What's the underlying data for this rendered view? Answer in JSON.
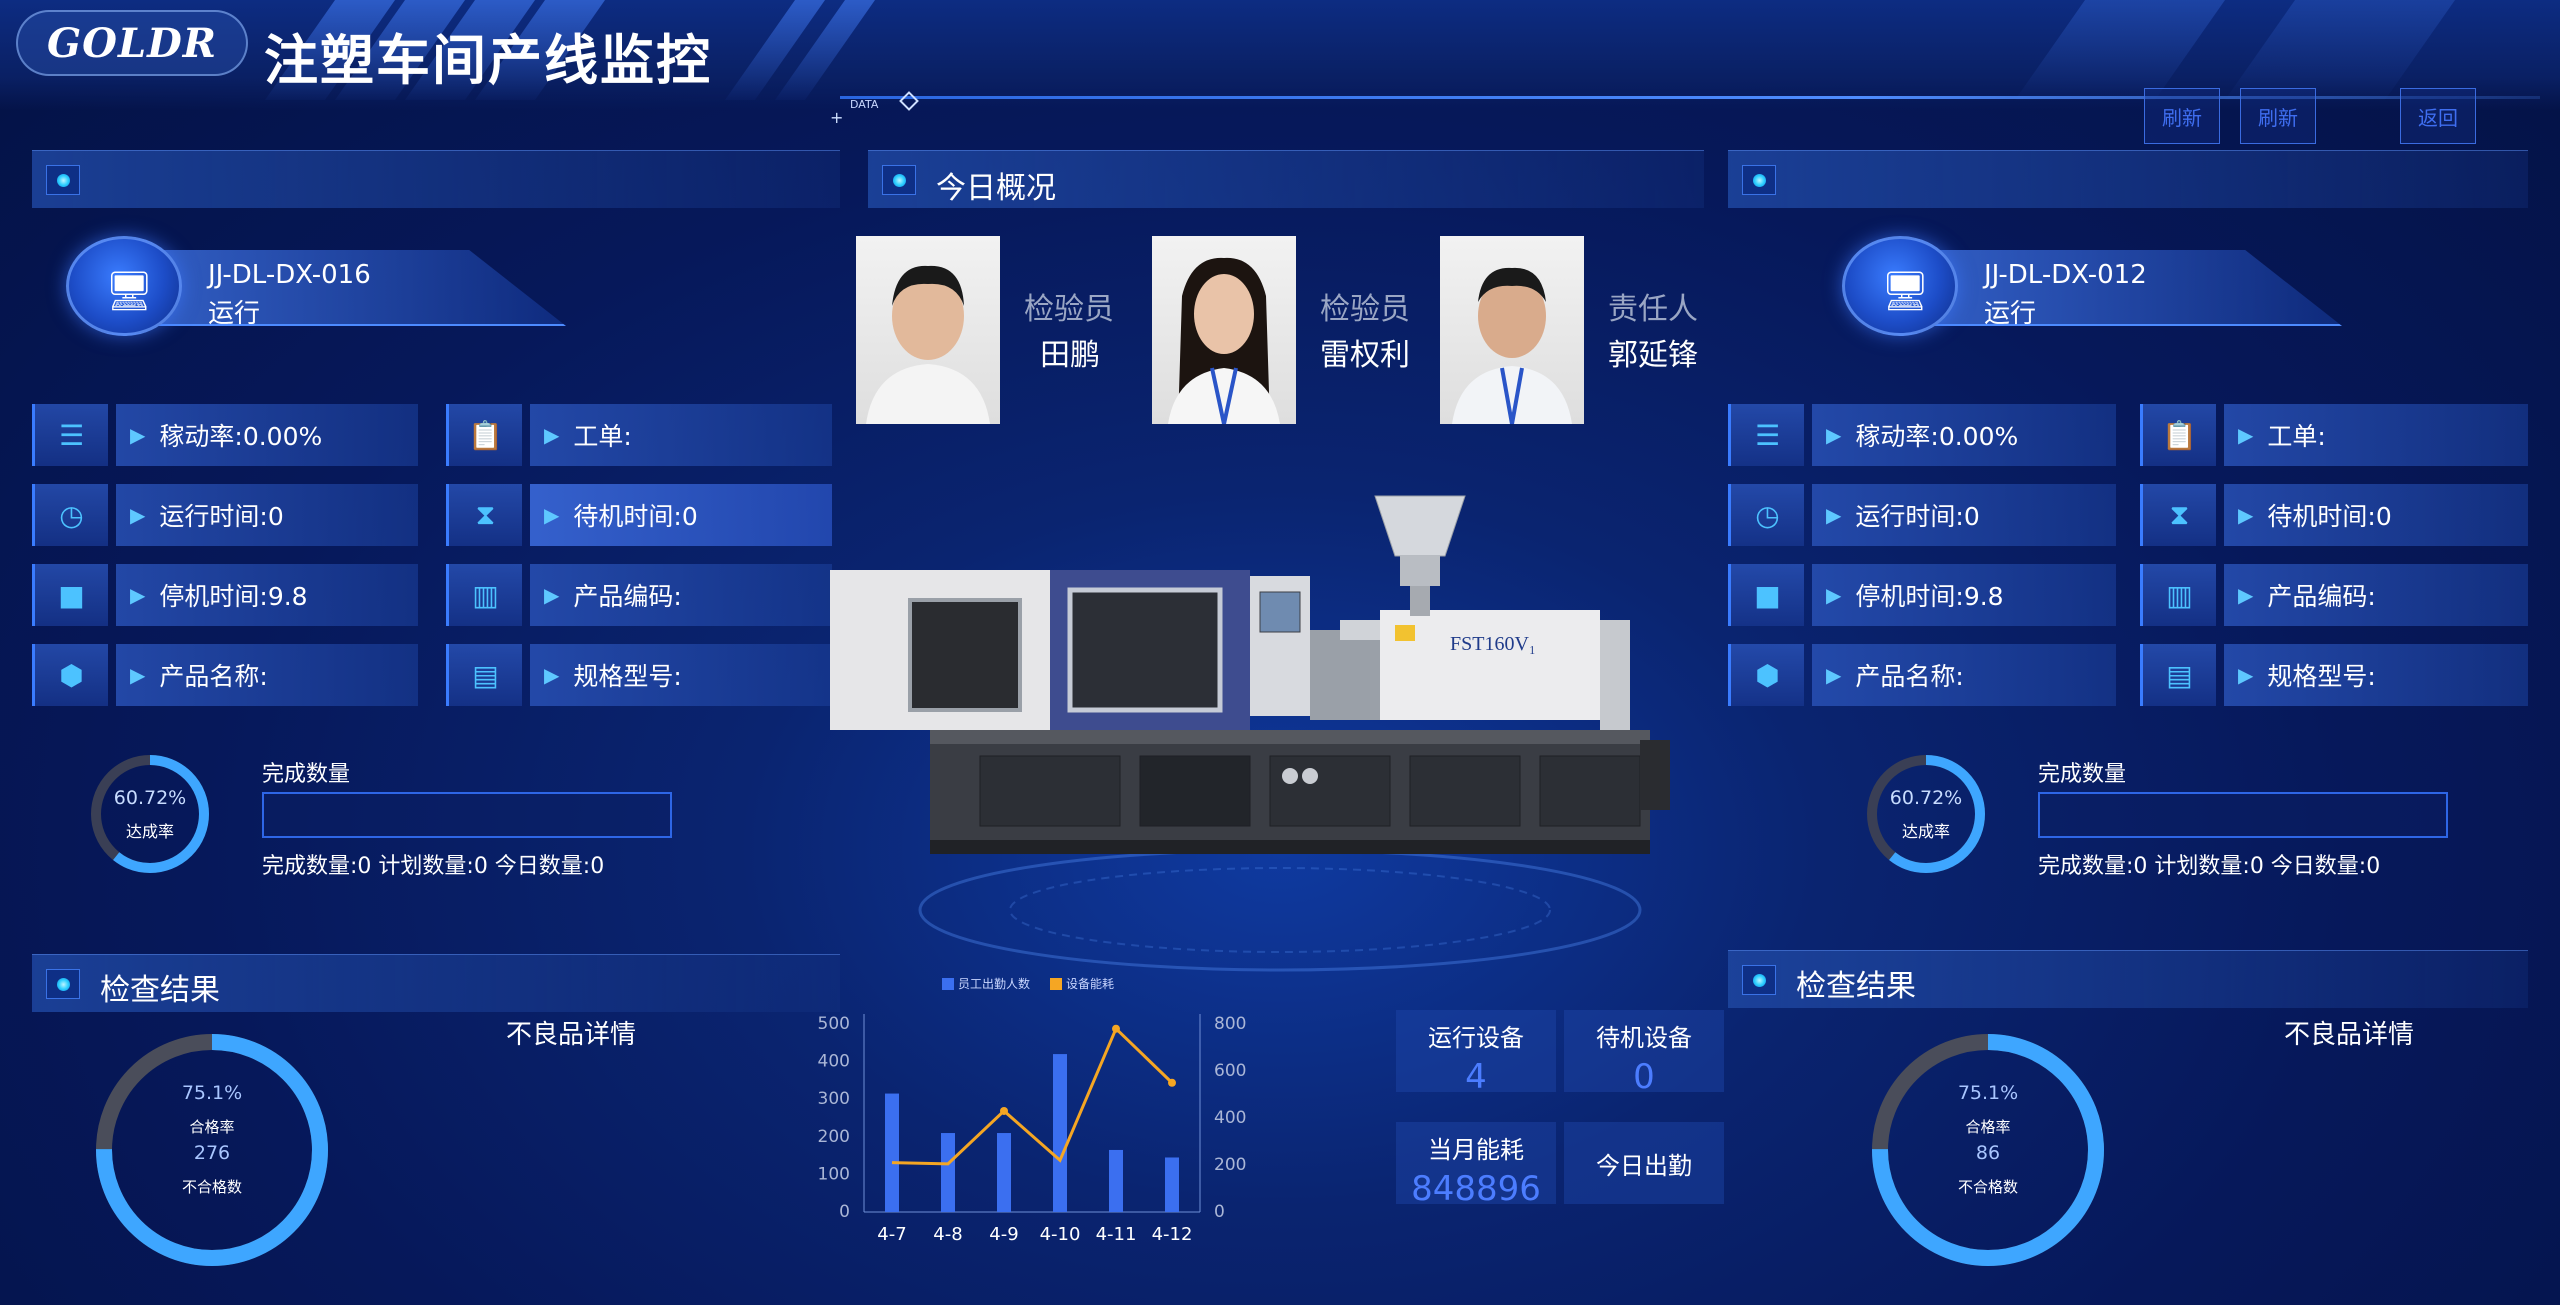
{
  "header": {
    "logo": "GOLDR",
    "title": "注塑车间产线监控",
    "data_tag": "DATA",
    "nav": [
      "刷新",
      "刷新",
      "返回"
    ]
  },
  "left_panel": {
    "machine_code": "JJ-DL-DX-016",
    "status": "运行",
    "rows": [
      {
        "icon": "server-icon",
        "label": "稼动率:0.00%"
      },
      {
        "icon": "clipboard-icon",
        "label": "工单:"
      },
      {
        "icon": "clock-icon",
        "label": "运行时间:0"
      },
      {
        "icon": "hourglass-icon",
        "label": "待机时间:0"
      },
      {
        "icon": "square-icon",
        "label": "停机时间:9.8"
      },
      {
        "icon": "barcode-icon",
        "label": "产品编码:"
      },
      {
        "icon": "cube-icon",
        "label": "产品名称:"
      },
      {
        "icon": "list-icon",
        "label": "规格型号:"
      }
    ],
    "achievement_rate": "60.72%",
    "achievement_label": "达成率",
    "achievement_value": 0.6072,
    "progress_title": "完成数量",
    "progress_value": 0,
    "progress_stats": "完成数量:0 计划数量:0 今日数量:0"
  },
  "right_panel": {
    "machine_code": "JJ-DL-DX-012",
    "status": "运行",
    "rows": [
      {
        "icon": "server-icon",
        "label": "稼动率:0.00%"
      },
      {
        "icon": "clipboard-icon",
        "label": "工单:"
      },
      {
        "icon": "clock-icon",
        "label": "运行时间:0"
      },
      {
        "icon": "hourglass-icon",
        "label": "待机时间:0"
      },
      {
        "icon": "square-icon",
        "label": "停机时间:9.8"
      },
      {
        "icon": "barcode-icon",
        "label": "产品编码:"
      },
      {
        "icon": "cube-icon",
        "label": "产品名称:"
      },
      {
        "icon": "list-icon",
        "label": "规格型号:"
      }
    ],
    "achievement_rate": "60.72%",
    "achievement_label": "达成率",
    "achievement_value": 0.6072,
    "progress_title": "完成数量",
    "progress_value": 0,
    "progress_stats": "完成数量:0 计划数量:0 今日数量:0"
  },
  "overview": {
    "title": "今日概况",
    "people": [
      {
        "role": "检验员",
        "name": "田鹏"
      },
      {
        "role": "检验员",
        "name": "雷权利"
      },
      {
        "role": "责任人",
        "name": "郭延锋"
      }
    ]
  },
  "inspection_left": {
    "title": "检查结果",
    "pass_rate": "75.1%",
    "pass_rate_value": 0.751,
    "pass_label": "合格率",
    "defect_count": "276",
    "defect_label": "不合格数",
    "defect_detail_title": "不良品详情"
  },
  "inspection_right": {
    "title": "检查结果",
    "pass_rate": "75.1%",
    "pass_rate_value": 0.751,
    "pass_label": "合格率",
    "defect_count": "86",
    "defect_label": "不合格数",
    "defect_detail_title": "不良品详情"
  },
  "chart_data": {
    "type": "bar",
    "categories": [
      "4-7",
      "4-8",
      "4-9",
      "4-10",
      "4-11",
      "4-12"
    ],
    "series": [
      {
        "name": "员工出勤人数",
        "type": "bar",
        "axis": "left",
        "color": "#3b6ff0",
        "values": [
          315,
          210,
          210,
          420,
          165,
          145
        ]
      },
      {
        "name": "设备能耗",
        "type": "line",
        "axis": "right",
        "color": "#f5a623",
        "values": [
          210,
          205,
          430,
          220,
          780,
          550
        ]
      }
    ],
    "left_axis": {
      "ylim": [
        0,
        500
      ],
      "ticks": [
        0,
        100,
        200,
        300,
        400,
        500
      ]
    },
    "right_axis": {
      "ylim": [
        0,
        800
      ],
      "ticks": [
        0,
        200,
        400,
        600,
        800
      ]
    },
    "legend_position": "top"
  },
  "stats": {
    "running_label": "运行设备",
    "running_value": "4",
    "standby_label": "待机设备",
    "standby_value": "0",
    "energy_label": "当月能耗",
    "energy_value": "848896",
    "attendance_label": "今日出勤"
  }
}
